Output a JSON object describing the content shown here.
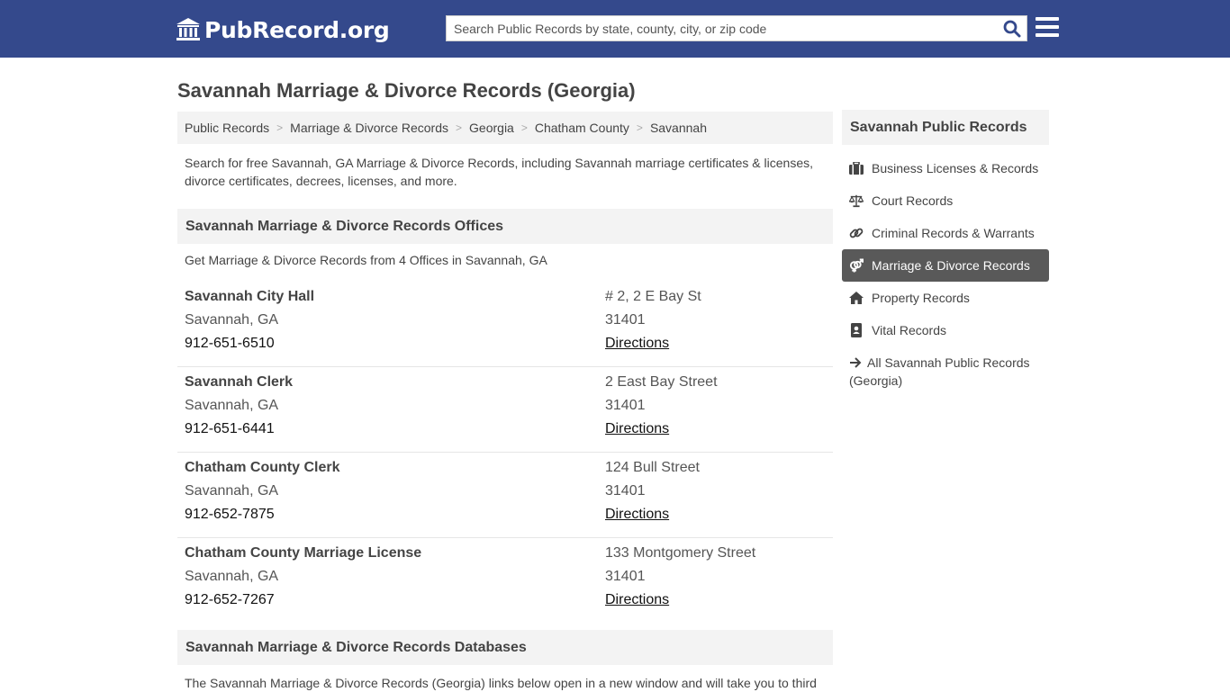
{
  "header": {
    "logo_text": "PubRecord.org",
    "search_placeholder": "Search Public Records by state, county, city, or zip code",
    "brand_color": "#34498c"
  },
  "page": {
    "title": "Savannah Marriage & Divorce Records (Georgia)",
    "intro": "Search for free Savannah, GA Marriage & Divorce Records, including Savannah marriage certificates & licenses, divorce certificates, decrees, licenses, and more."
  },
  "breadcrumb": [
    "Public Records",
    "Marriage & Divorce Records",
    "Georgia",
    "Chatham County",
    "Savannah"
  ],
  "offices": {
    "heading": "Savannah Marriage & Divorce Records Offices",
    "subtitle": "Get Marriage & Divorce Records from 4 Offices in Savannah, GA",
    "items": [
      {
        "name": "Savannah City Hall",
        "city": "Savannah, GA",
        "phone": "912-651-6510",
        "address": "# 2, 2 E Bay St",
        "zip": "31401",
        "directions": "Directions"
      },
      {
        "name": "Savannah Clerk",
        "city": "Savannah, GA",
        "phone": "912-651-6441",
        "address": "2 East Bay Street",
        "zip": "31401",
        "directions": "Directions"
      },
      {
        "name": "Chatham County Clerk",
        "city": "Savannah, GA",
        "phone": "912-652-7875",
        "address": "124 Bull Street",
        "zip": "31401",
        "directions": "Directions"
      },
      {
        "name": "Chatham County Marriage License",
        "city": "Savannah, GA",
        "phone": "912-652-7267",
        "address": "133 Montgomery Street",
        "zip": "31401",
        "directions": "Directions"
      }
    ]
  },
  "databases": {
    "heading": "Savannah Marriage & Divorce Records Databases",
    "text": "The Savannah Marriage & Divorce Records (Georgia) links below open in a new window and will take you to third"
  },
  "sidebar": {
    "heading": "Savannah Public Records",
    "items": [
      {
        "label": "Business Licenses & Records",
        "icon": "briefcase-icon"
      },
      {
        "label": "Court Records",
        "icon": "scale-icon"
      },
      {
        "label": "Criminal Records & Warrants",
        "icon": "link-icon"
      },
      {
        "label": "Marriage & Divorce Records",
        "icon": "gender-icon",
        "active": true
      },
      {
        "label": "Property Records",
        "icon": "home-icon"
      },
      {
        "label": "Vital Records",
        "icon": "vital-book-icon"
      }
    ],
    "all_link": "All Savannah Public Records (Georgia)",
    "active_color": "#595959"
  }
}
